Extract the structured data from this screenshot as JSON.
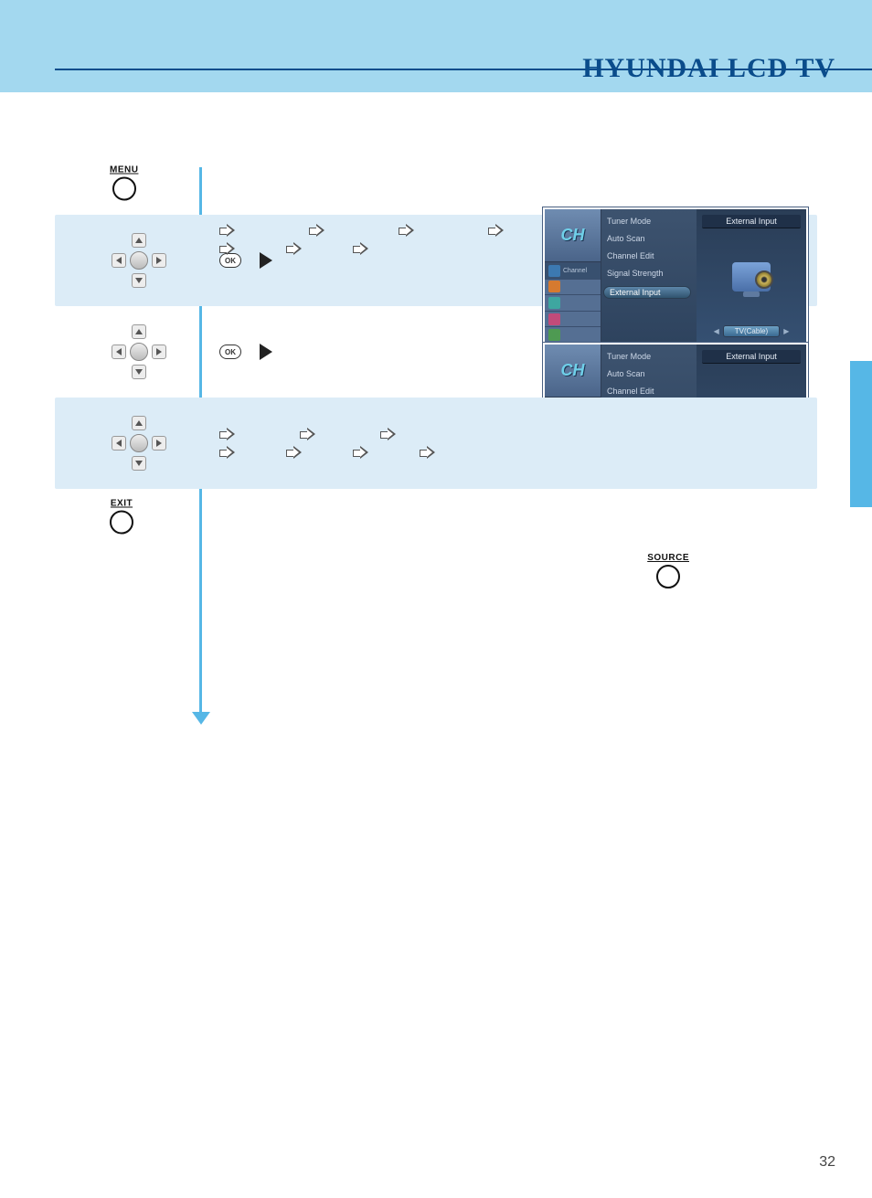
{
  "header": {
    "brand_title": "HYUNDAI LCD TV"
  },
  "page_number": "32",
  "remote_buttons": {
    "menu_label": "MENU",
    "exit_label": "EXIT",
    "source_label": "SOURCE",
    "ok_label": "OK"
  },
  "osd_common": {
    "logo_text": "CH",
    "side_icons": [
      {
        "label": "Channel",
        "color": "#3c79b1",
        "selected": true
      },
      {
        "label": "",
        "color": "#d67a2f",
        "selected": false
      },
      {
        "label": "",
        "color": "#3ea6a0",
        "selected": false
      },
      {
        "label": "",
        "color": "#c24b7a",
        "selected": false
      },
      {
        "label": "",
        "color": "#4e9a52",
        "selected": false
      }
    ],
    "menu_items": [
      "Tuner Mode",
      "Auto Scan",
      "Channel Edit",
      "Signal Strength",
      "External Input"
    ],
    "right_panel_title": "External Input",
    "value_label": "TV(Cable)"
  },
  "osd_variant_a": {
    "selected_index": 4,
    "value_highlight": "blue"
  },
  "osd_variant_b": {
    "selected_index": 4,
    "value_highlight": "yellow"
  },
  "arrow_sequence_a": {
    "row1_count": 3,
    "row2_count": 4
  },
  "arrow_sequence_b": {
    "row1_count": 4,
    "row2_count": 3
  }
}
